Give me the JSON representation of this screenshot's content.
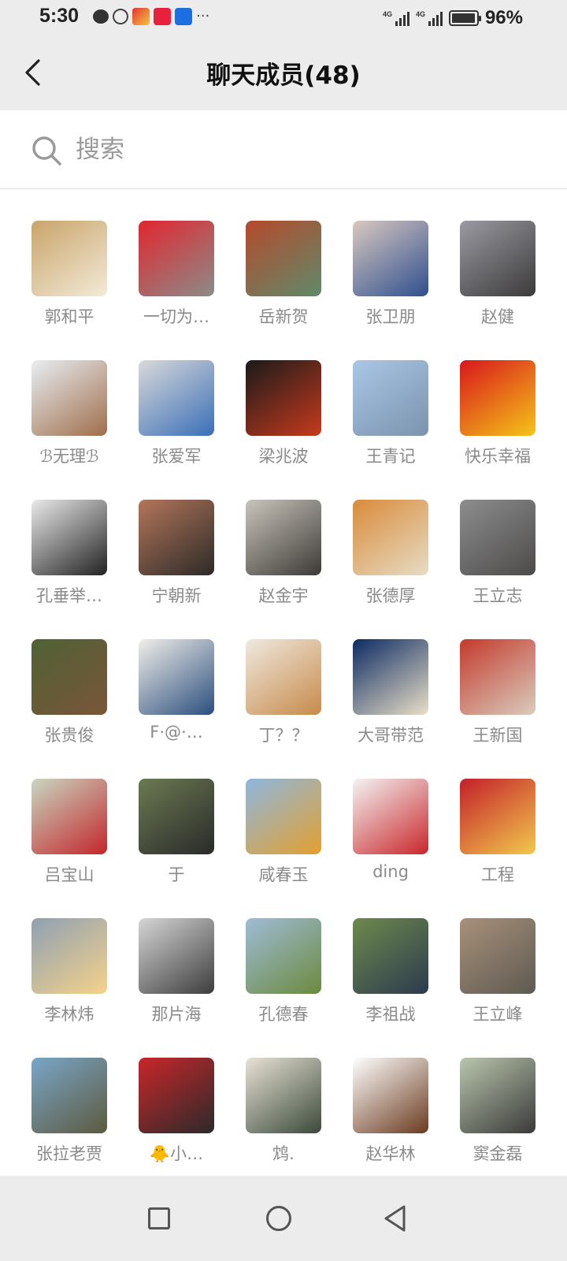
{
  "status_bar": {
    "time": "5:30",
    "network_1": "4G",
    "network_2": "4G",
    "battery": "96%",
    "battery_level": 0.96
  },
  "header": {
    "title": "聊天成员(48)"
  },
  "search": {
    "placeholder": "搜索",
    "value": ""
  },
  "members": [
    {
      "name": "郭和平",
      "avatar": [
        "#c9a46b",
        "#f2ead7"
      ]
    },
    {
      "name": "一切为…",
      "avatar": [
        "#e2262f",
        "#8a8c88"
      ]
    },
    {
      "name": "岳新贺",
      "avatar": [
        "#b54a2c",
        "#5f8a6a"
      ]
    },
    {
      "name": "张卫朋",
      "avatar": [
        "#d9c8c0",
        "#2f4f8f"
      ]
    },
    {
      "name": "赵健",
      "avatar": [
        "#9a9aa2",
        "#3c3a3a"
      ]
    },
    {
      "name": "ℬ无理ℬ",
      "avatar": [
        "#e8eef3",
        "#a06e4a"
      ]
    },
    {
      "name": "张爱军",
      "avatar": [
        "#d9d9d9",
        "#3a6fb8"
      ]
    },
    {
      "name": "梁兆波",
      "avatar": [
        "#1a1a1a",
        "#c73a1d"
      ]
    },
    {
      "name": "王青记",
      "avatar": [
        "#a9c7e6",
        "#7b93ad"
      ]
    },
    {
      "name": "快乐幸福",
      "avatar": [
        "#d8161c",
        "#f5c518"
      ]
    },
    {
      "name": "孔垂举…",
      "avatar": [
        "#eaeaea",
        "#222222"
      ]
    },
    {
      "name": "宁朝新",
      "avatar": [
        "#b2765a",
        "#2d2a28"
      ]
    },
    {
      "name": "赵金宇",
      "avatar": [
        "#c9c4bb",
        "#3d3a36"
      ]
    },
    {
      "name": "张德厚",
      "avatar": [
        "#d98b3a",
        "#e6dcc5"
      ]
    },
    {
      "name": "王立志",
      "avatar": [
        "#8d8d8f",
        "#4d4b49"
      ]
    },
    {
      "name": "张贵俊",
      "avatar": [
        "#4f6136",
        "#7a5638"
      ]
    },
    {
      "name": "F·@·…",
      "avatar": [
        "#f0eee9",
        "#2c4f7e"
      ]
    },
    {
      "name": "丁？？",
      "avatar": [
        "#efe9df",
        "#c78a4a"
      ]
    },
    {
      "name": "大哥带范",
      "avatar": [
        "#0c2a63",
        "#e9dfc6"
      ]
    },
    {
      "name": "王新国",
      "avatar": [
        "#c33a2c",
        "#d9ccbd"
      ]
    },
    {
      "name": "吕宝山",
      "avatar": [
        "#c9d7c2",
        "#c3262a"
      ]
    },
    {
      "name": "于",
      "avatar": [
        "#6b7a52",
        "#2a2a2a"
      ]
    },
    {
      "name": "咸春玉",
      "avatar": [
        "#8fb7df",
        "#e3a02e"
      ]
    },
    {
      "name": "ding",
      "avatar": [
        "#f4f4f4",
        "#c9262a"
      ]
    },
    {
      "name": "工程",
      "avatar": [
        "#c31f2a",
        "#f2c94c"
      ]
    },
    {
      "name": "李林炜",
      "avatar": [
        "#8fa0b3",
        "#f5d28a"
      ]
    },
    {
      "name": "那片海",
      "avatar": [
        "#d6d6d6",
        "#3d3d3d"
      ]
    },
    {
      "name": "孔德春",
      "avatar": [
        "#9fbcd8",
        "#6b8a3c"
      ]
    },
    {
      "name": "李祖战",
      "avatar": [
        "#6e8a4c",
        "#2b3a4f"
      ]
    },
    {
      "name": "王立峰",
      "avatar": [
        "#a8907a",
        "#5e5a52"
      ]
    },
    {
      "name": "张拉老贾",
      "avatar": [
        "#7aa6c9",
        "#5c5a3e"
      ]
    },
    {
      "name": "🐥小…",
      "avatar": [
        "#c9262a",
        "#2a2a2a"
      ]
    },
    {
      "name": "鸩.",
      "avatar": [
        "#e8e2d5",
        "#3a4a3a"
      ]
    },
    {
      "name": "赵华林",
      "avatar": [
        "#ffffff",
        "#6b3a1e"
      ]
    },
    {
      "name": "窦金磊",
      "avatar": [
        "#b9c6ad",
        "#3a3a3a"
      ]
    }
  ],
  "colors": {
    "header_bg": "#ececec",
    "name_text": "#8a8a8a",
    "title_text": "#111111"
  }
}
